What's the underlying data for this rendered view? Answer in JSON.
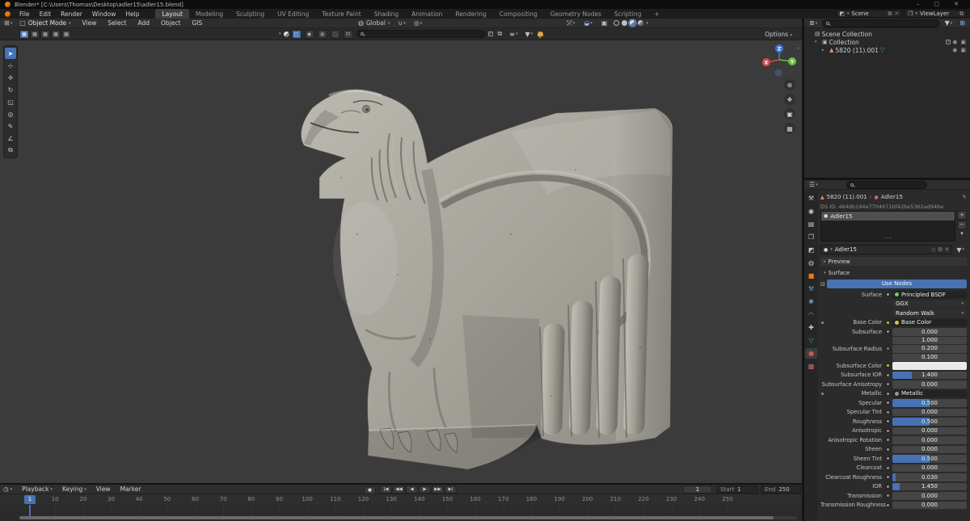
{
  "window": {
    "title": "Blender* [C:\\Users\\Thomas\\Desktop\\adler15\\adler15.blend]",
    "controls": [
      {
        "name": "minimize-button",
        "glyph": "–"
      },
      {
        "name": "maximize-button",
        "glyph": "▢"
      },
      {
        "name": "close-button",
        "glyph": "✕"
      }
    ]
  },
  "topbar": {
    "app_menus": [
      "File",
      "Edit",
      "Render",
      "Window",
      "Help"
    ],
    "workspaces": [
      "Layout",
      "Modeling",
      "Sculpting",
      "UV Editing",
      "Texture Paint",
      "Shading",
      "Animation",
      "Rendering",
      "Compositing",
      "Geometry Nodes",
      "Scripting",
      "+"
    ],
    "active_workspace": "Layout",
    "scene_name": "Scene",
    "view_layer_name": "ViewLayer"
  },
  "viewport": {
    "mode": "Object Mode",
    "menus": [
      "View",
      "Select",
      "Add",
      "Object",
      "GIS"
    ],
    "orientation": "Global",
    "options_label": "Options",
    "select_modes": [
      "new",
      "extend",
      "subtract",
      "invert",
      "intersect"
    ],
    "tools": [
      {
        "name": "select-box-tool",
        "glyph": "➤",
        "active": true
      },
      {
        "name": "cursor-tool",
        "glyph": "⊹",
        "active": false
      },
      {
        "name": "move-tool",
        "glyph": "✛",
        "active": false
      },
      {
        "name": "rotate-tool",
        "glyph": "↻",
        "active": false
      },
      {
        "name": "scale-tool",
        "glyph": "◱",
        "active": false
      },
      {
        "name": "transform-tool",
        "glyph": "◎",
        "active": false
      },
      {
        "name": "annotate-tool",
        "glyph": "✎",
        "active": false
      },
      {
        "name": "measure-tool",
        "glyph": "∠",
        "active": false
      },
      {
        "name": "add-cube-tool",
        "glyph": "⧉",
        "active": false
      }
    ],
    "nav_icons": [
      {
        "name": "zoom-icon",
        "glyph": "⊕"
      },
      {
        "name": "pan-hand-icon",
        "glyph": "❖"
      },
      {
        "name": "camera-view-icon",
        "glyph": "▣"
      },
      {
        "name": "toggle-ortho-icon",
        "glyph": "▦"
      }
    ],
    "gizmo": {
      "x": "X",
      "y": "Y",
      "z": "Z",
      "x_color": "#d94c4c",
      "y_color": "#6cbf3f",
      "z_color": "#3f76d4"
    }
  },
  "outliner": {
    "rows": [
      {
        "label": "Scene Collection",
        "icon": "scene-collection-icon",
        "glyph": "▤",
        "depth": 0,
        "disclosure": "",
        "toggles": []
      },
      {
        "label": "Collection",
        "icon": "collection-icon",
        "glyph": "▣",
        "depth": 1,
        "disclosure": "▾",
        "toggles": [
          "checkbox",
          "eye",
          "camera"
        ]
      },
      {
        "label": "5820 (11).001",
        "icon": "mesh-object-icon",
        "glyph": "▲",
        "icon_color": "#e8935b",
        "depth": 2,
        "disclosure": "▸",
        "extra": {
          "name": "mesh-data-icon",
          "glyph": "▽",
          "color": "#43b36a"
        },
        "toggles": [
          "eye",
          "camera"
        ]
      }
    ]
  },
  "properties": {
    "tabs": [
      {
        "name": "tool",
        "glyph": "⚒",
        "color": "#c8c8c8"
      },
      {
        "name": "render",
        "glyph": "◉",
        "color": "#c8c8c8"
      },
      {
        "name": "output",
        "glyph": "▤",
        "color": "#c8c8c8"
      },
      {
        "name": "view-layer",
        "glyph": "❐",
        "color": "#c8c8c8"
      },
      {
        "name": "scene",
        "glyph": "◩",
        "color": "#c8c8c8"
      },
      {
        "name": "world",
        "glyph": "◍",
        "color": "#c8c8c8"
      },
      {
        "name": "object",
        "glyph": "■",
        "color": "#e87d0d"
      },
      {
        "name": "modifiers",
        "glyph": "⚒",
        "color": "#6f9ad1"
      },
      {
        "name": "particles",
        "glyph": "✱",
        "color": "#6f9ad1"
      },
      {
        "name": "physics",
        "glyph": "◠",
        "color": "#6f9ad1"
      },
      {
        "name": "constraints",
        "glyph": "✚",
        "color": "#c8c8c8"
      },
      {
        "name": "data",
        "glyph": "▽",
        "color": "#43b36a"
      },
      {
        "name": "material",
        "glyph": "●",
        "color": "#d05454",
        "active": true
      },
      {
        "name": "texture",
        "glyph": "▩",
        "color": "#c46b6b"
      }
    ],
    "breadcrumb": {
      "object": "5820 (11).001",
      "separator": "›",
      "material": "Adler15"
    },
    "ds_id": "DS ID: 464db194e7704671bf42be5362ad94be",
    "slot": {
      "name": "Adler15"
    },
    "material_name": "Adler15",
    "preview_label": "Preview",
    "surface_label": "Surface",
    "use_nodes_label": "Use Nodes",
    "rows": [
      {
        "label": "Surface",
        "type": "node",
        "value": "Principled BSDF",
        "socket": "#6ccc6c"
      },
      {
        "label": "",
        "type": "dropdown",
        "value": "GGX"
      },
      {
        "label": "",
        "type": "dropdown",
        "value": "Random Walk"
      },
      {
        "label": "Base Color",
        "type": "node",
        "value": "Base Color",
        "socket": "#d8c832",
        "expander": true
      },
      {
        "label": "Subsurface",
        "type": "slider",
        "value": "0.000",
        "fill": 0,
        "socket": "#9a9a9a"
      },
      {
        "label": "Subsurface Radius",
        "type": "vector",
        "values": [
          "1.000",
          "0.200",
          "0.100"
        ],
        "socket": "#7a77d9"
      },
      {
        "label": "Subsurface Color",
        "type": "color",
        "swatch": "#e9e9e9",
        "socket": "#d8c832"
      },
      {
        "label": "Subsurface IOR",
        "type": "slider",
        "value": "1.400",
        "fill": 0.26,
        "socket": "#9a9a9a"
      },
      {
        "label": "Subsurface Anisotropy",
        "type": "slider",
        "value": "0.000",
        "fill": 0,
        "socket": "#9a9a9a"
      },
      {
        "label": "Metallic",
        "type": "node",
        "value": "Metallic",
        "socket": "#9a9a9a",
        "expander": true
      },
      {
        "label": "Specular",
        "type": "slider",
        "value": "0.500",
        "fill": 0.5,
        "socket": "#9a9a9a"
      },
      {
        "label": "Specular Tint",
        "type": "slider",
        "value": "0.000",
        "fill": 0,
        "socket": "#9a9a9a"
      },
      {
        "label": "Roughness",
        "type": "slider",
        "value": "0.500",
        "fill": 0.5,
        "socket": "#9a9a9a"
      },
      {
        "label": "Anisotropic",
        "type": "slider",
        "value": "0.000",
        "fill": 0,
        "socket": "#9a9a9a"
      },
      {
        "label": "Anisotropic Rotation",
        "type": "slider",
        "value": "0.000",
        "fill": 0,
        "socket": "#9a9a9a"
      },
      {
        "label": "Sheen",
        "type": "slider",
        "value": "0.000",
        "fill": 0,
        "socket": "#9a9a9a"
      },
      {
        "label": "Sheen Tint",
        "type": "slider",
        "value": "0.500",
        "fill": 0.5,
        "socket": "#9a9a9a"
      },
      {
        "label": "Clearcoat",
        "type": "slider",
        "value": "0.000",
        "fill": 0,
        "socket": "#9a9a9a"
      },
      {
        "label": "Clearcoat Roughness",
        "type": "slider",
        "value": "0.030",
        "fill": 0.04,
        "socket": "#9a9a9a"
      },
      {
        "label": "IOR",
        "type": "slider",
        "value": "1.450",
        "fill": 0.1,
        "socket": "#9a9a9a"
      },
      {
        "label": "Transmission",
        "type": "slider",
        "value": "0.000",
        "fill": 0,
        "socket": "#9a9a9a"
      },
      {
        "label": "Transmission Roughness",
        "type": "slider",
        "value": "0.000",
        "fill": 0,
        "socket": "#9a9a9a"
      }
    ]
  },
  "timeline": {
    "menus": [
      "Playback",
      "Keying",
      "View",
      "Marker"
    ],
    "transport": [
      {
        "name": "jump-to-start-button",
        "glyph": "|◀"
      },
      {
        "name": "prev-keyframe-button",
        "glyph": "◀◀"
      },
      {
        "name": "play-reverse-button",
        "glyph": "◀"
      },
      {
        "name": "play-button",
        "glyph": "▶"
      },
      {
        "name": "next-keyframe-button",
        "glyph": "▶▶"
      },
      {
        "name": "jump-to-end-button",
        "glyph": "▶|"
      }
    ],
    "auto_key_glyph": "●",
    "current_frame": "1",
    "start_label": "Start",
    "start": "1",
    "end_label": "End",
    "end": "250",
    "frame_labels": [
      1,
      10,
      20,
      30,
      40,
      50,
      60,
      70,
      80,
      90,
      100,
      110,
      120,
      130,
      140,
      150,
      160,
      170,
      180,
      190,
      200,
      210,
      220,
      230,
      240,
      250
    ]
  },
  "colors": {
    "accent_blue": "#4772b3",
    "object_orange": "#e87d0d",
    "data_green": "#43b36a",
    "notification_orange": "#e6a23c"
  }
}
